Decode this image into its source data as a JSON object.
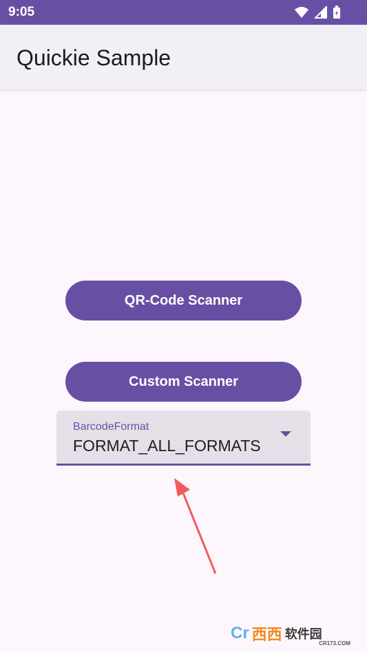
{
  "status_bar": {
    "time": "9:05",
    "icons": [
      "wifi-icon",
      "signal-icon",
      "battery-icon"
    ],
    "color": "#6750a4"
  },
  "app_bar": {
    "title": "Quickie Sample"
  },
  "buttons": {
    "qr_scanner": "QR-Code Scanner",
    "custom_scanner": "Custom Scanner"
  },
  "barcode_dropdown": {
    "label": "BarcodeFormat",
    "value": "FORMAT_ALL_FORMATS"
  },
  "colors": {
    "primary": "#6750a4",
    "background": "#fdf7fd",
    "annotation_arrow": "#f05a5a"
  },
  "watermark": {
    "brand_prefix": "Cr",
    "brand_chars": "西西",
    "brand_suffix": "软件园",
    "url": "CR173.COM"
  }
}
